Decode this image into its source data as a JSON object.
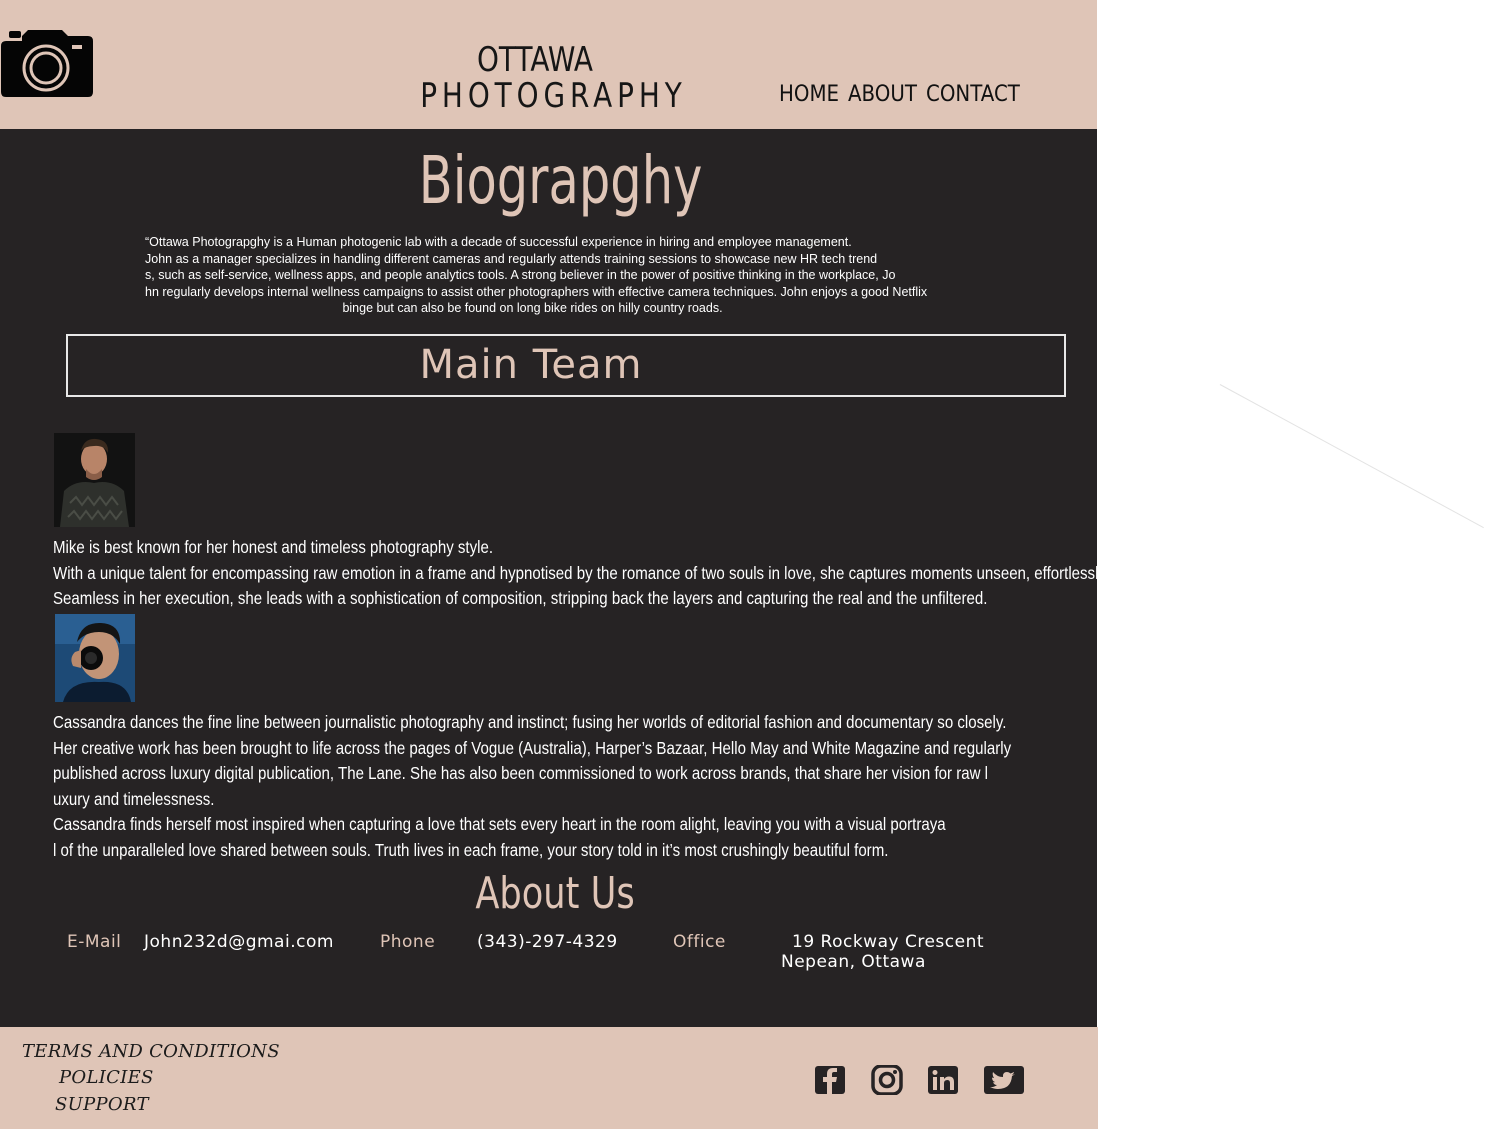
{
  "header": {
    "logo_icon": "camera-icon",
    "brand_line1": "OTTAWA",
    "brand_line2": "PHOTOGRAPHY",
    "nav": [
      {
        "label": "HOME"
      },
      {
        "label": "ABOUT"
      },
      {
        "label": "CONTACT"
      }
    ]
  },
  "biography": {
    "title": "Biograpghy",
    "lines": [
      "“Ottawa Photograpghy is a Human photogenic lab with a decade of successful experience in hiring and employee management.",
      " John as a manager specializes in handling different cameras and regularly attends training sessions to showcase new HR tech trend",
      "s, such as self-service, wellness apps, and people analytics tools. A strong believer in the power of positive thinking in the workplace, Jo",
      "hn regularly develops internal wellness campaigns to assist other photographers with effective camera techniques. John enjoys a good Netflix",
      "binge but can also be found on long bike rides on hilly country roads."
    ]
  },
  "team": {
    "title": "Main Team",
    "members": [
      {
        "name": "Mike",
        "lines": [
          "Mike is best known for her honest and timeless photography style.",
          "With a unique talent for encompassing raw emotion in a frame and hypnotised by the romance of two souls in love, she captures moments unseen, effortlessly.",
          "Seamless in her execution, she leads with a sophistication of composition, stripping back the layers and capturing the real and the unfiltered."
        ]
      },
      {
        "name": "Cassandra",
        "lines": [
          "Cassandra dances the fine line between journalistic photography and instinct; fusing her worlds of editorial fashion and documentary so closely.",
          " Her creative work has been brought to life across the pages of Vogue (Australia), Harper’s Bazaar, Hello May and White Magazine and regularly",
          " published across luxury digital publication, The Lane. She has also been commissioned to work across brands, that share her vision for raw l",
          "uxury and timelessness.",
          "Cassandra finds herself most inspired when capturing a love that sets every heart in the room alight, leaving you with a visual portraya",
          "l of the unparalleled love shared between souls. Truth lives in each frame, your story told in it’s most crushingly beautiful form."
        ]
      }
    ]
  },
  "about": {
    "title": "About Us",
    "email_label": "E-Mail",
    "email": "John232d@gmai.com",
    "phone_label": "Phone",
    "phone": "(343)-297-4329",
    "office_label": "Office",
    "office_line1": "19 Rockway Crescent",
    "office_line2": "Nepean, Ottawa"
  },
  "footer": {
    "links": [
      {
        "label": "TERMS AND CONDITIONS"
      },
      {
        "label": "POLICIES"
      },
      {
        "label": "SUPPORT"
      }
    ],
    "social": [
      "facebook-icon",
      "instagram-icon",
      "linkedin-icon",
      "twitter-icon"
    ]
  },
  "colors": {
    "beige": "#dfc5b7",
    "dark": "#262324"
  }
}
